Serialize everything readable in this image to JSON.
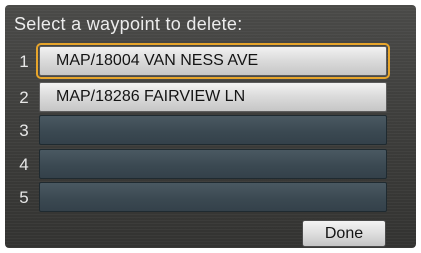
{
  "title": "Select a waypoint to delete:",
  "waypoints": [
    {
      "number": "1",
      "label": "MAP/18004 VAN NESS AVE",
      "selected": true
    },
    {
      "number": "2",
      "label": "MAP/18286 FAIRVIEW LN",
      "selected": false
    },
    {
      "number": "3",
      "label": "",
      "selected": false
    },
    {
      "number": "4",
      "label": "",
      "selected": false
    },
    {
      "number": "5",
      "label": "",
      "selected": false
    }
  ],
  "done_label": "Done",
  "colors": {
    "selection_outline": "#e7a52b",
    "background": "#3d3d3b",
    "empty_slot": "#3b4952"
  }
}
